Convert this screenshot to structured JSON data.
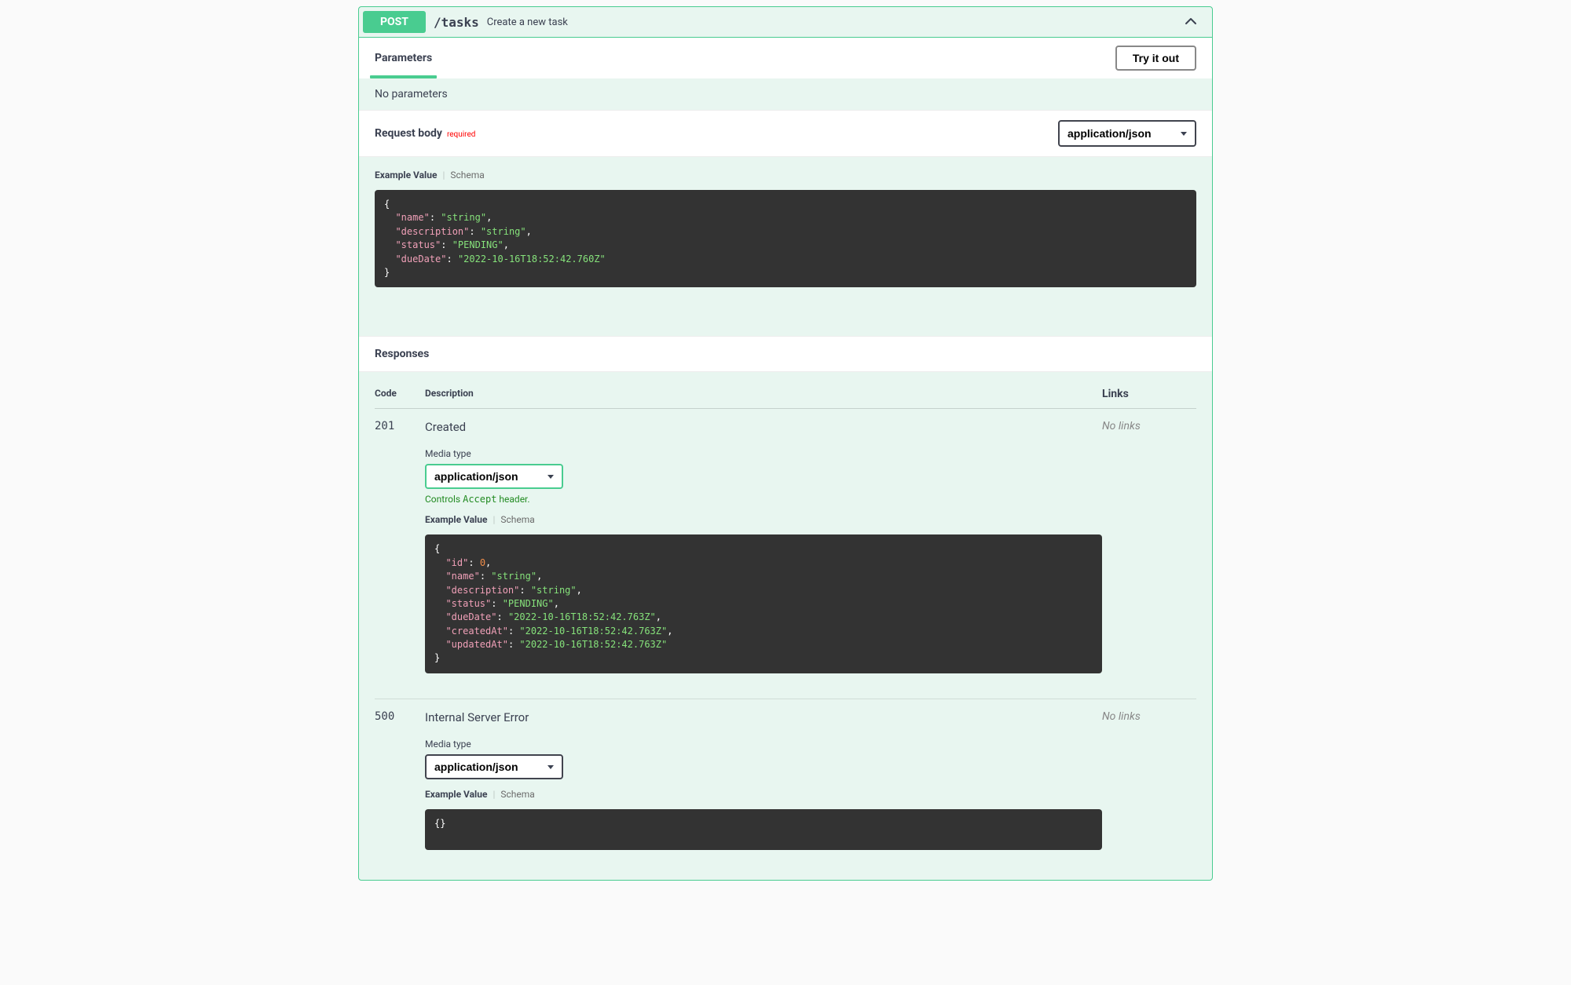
{
  "operation": {
    "method": "POST",
    "path": "/tasks",
    "summary": "Create a new task"
  },
  "parameters": {
    "tab_label": "Parameters",
    "try_button": "Try it out",
    "empty_text": "No parameters"
  },
  "request_body": {
    "title": "Request body",
    "required_label": "required",
    "content_type": "application/json",
    "tabs": {
      "example": "Example Value",
      "schema": "Schema"
    },
    "example": {
      "name": "string",
      "description": "string",
      "status": "PENDING",
      "dueDate": "2022-10-16T18:52:42.760Z"
    }
  },
  "responses": {
    "title": "Responses",
    "columns": {
      "code": "Code",
      "description": "Description",
      "links": "Links"
    },
    "no_links": "No links",
    "media_type_label": "Media type",
    "accept_note_pre": "Controls ",
    "accept_note_code": "Accept",
    "accept_note_post": " header.",
    "tabs": {
      "example": "Example Value",
      "schema": "Schema"
    },
    "items": [
      {
        "code": "201",
        "description": "Created",
        "content_type": "application/json",
        "show_accept_note": true,
        "example": {
          "id": 0,
          "name": "string",
          "description": "string",
          "status": "PENDING",
          "dueDate": "2022-10-16T18:52:42.763Z",
          "createdAt": "2022-10-16T18:52:42.763Z",
          "updatedAt": "2022-10-16T18:52:42.763Z"
        }
      },
      {
        "code": "500",
        "description": "Internal Server Error",
        "content_type": "application/json",
        "show_accept_note": false,
        "example": {}
      }
    ]
  }
}
